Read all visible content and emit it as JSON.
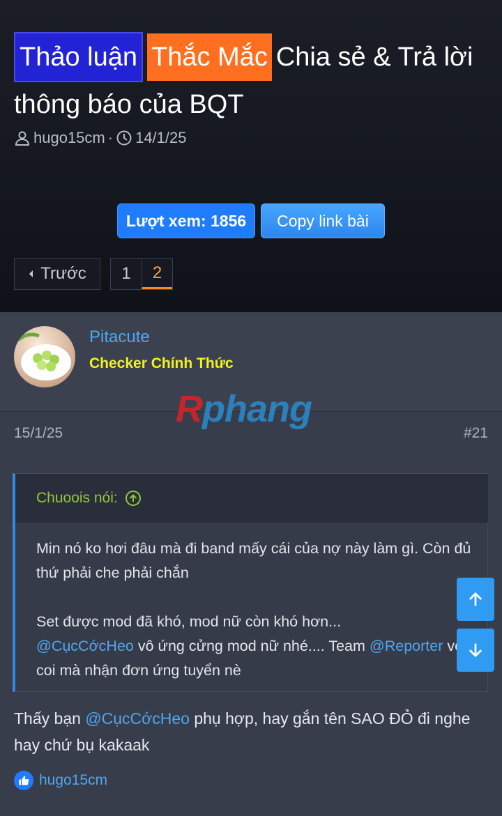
{
  "thread": {
    "prefix_1": "Thảo luận",
    "prefix_2": "Thắc Mắc",
    "title_rest": "Chia sẻ & Trả lời thông báo của BQT",
    "author": "hugo15cm",
    "separator": "·",
    "date": "14/1/25"
  },
  "buttons": {
    "views": "Lượt xem: 1856",
    "copy_link": "Copy link bài"
  },
  "pagination": {
    "prev": "Trước",
    "pages": [
      "1",
      "2"
    ],
    "current": "2"
  },
  "post": {
    "username": "Pitacute",
    "user_title": "Checker Chính Thức",
    "date": "15/1/25",
    "number": "#21",
    "watermark_r": "R",
    "watermark_rest": "phang",
    "quote": {
      "author_label": "Chuoois nói:",
      "line1": "Min nó ko hơi đâu mà đi band mấy cái của nợ này làm gì. Còn đủ thứ phải che phải chắn",
      "line2": "Set được mod đã khó, mod nữ còn khó hơn...",
      "mention1": "@CụcCớcHeo",
      "line3": " vô ứng cửng mod nữ nhé.... Team ",
      "mention2": "@Reporter",
      "line4": " vô coi mà nhận đơn ứng tuyển nè"
    },
    "reply": {
      "part1": "Thấy bạn ",
      "mention": "@CụcCớcHeo",
      "part2": " phụ hợp, hay gắn tên SAO ĐỎ đi nghe hay chứ bụ kakaak"
    },
    "reaction_user": "hugo15cm"
  },
  "colors": {
    "accent_blue": "#2f9bf2",
    "user_title_yellow": "#f2f21f",
    "quote_author_green": "#8fc83b",
    "active_page_orange": "#ff8a1f"
  },
  "icons": [
    "user-icon",
    "clock-icon",
    "caret-left-icon",
    "arrow-up-circle-icon",
    "like-icon",
    "arrow-up-icon",
    "arrow-down-icon"
  ]
}
